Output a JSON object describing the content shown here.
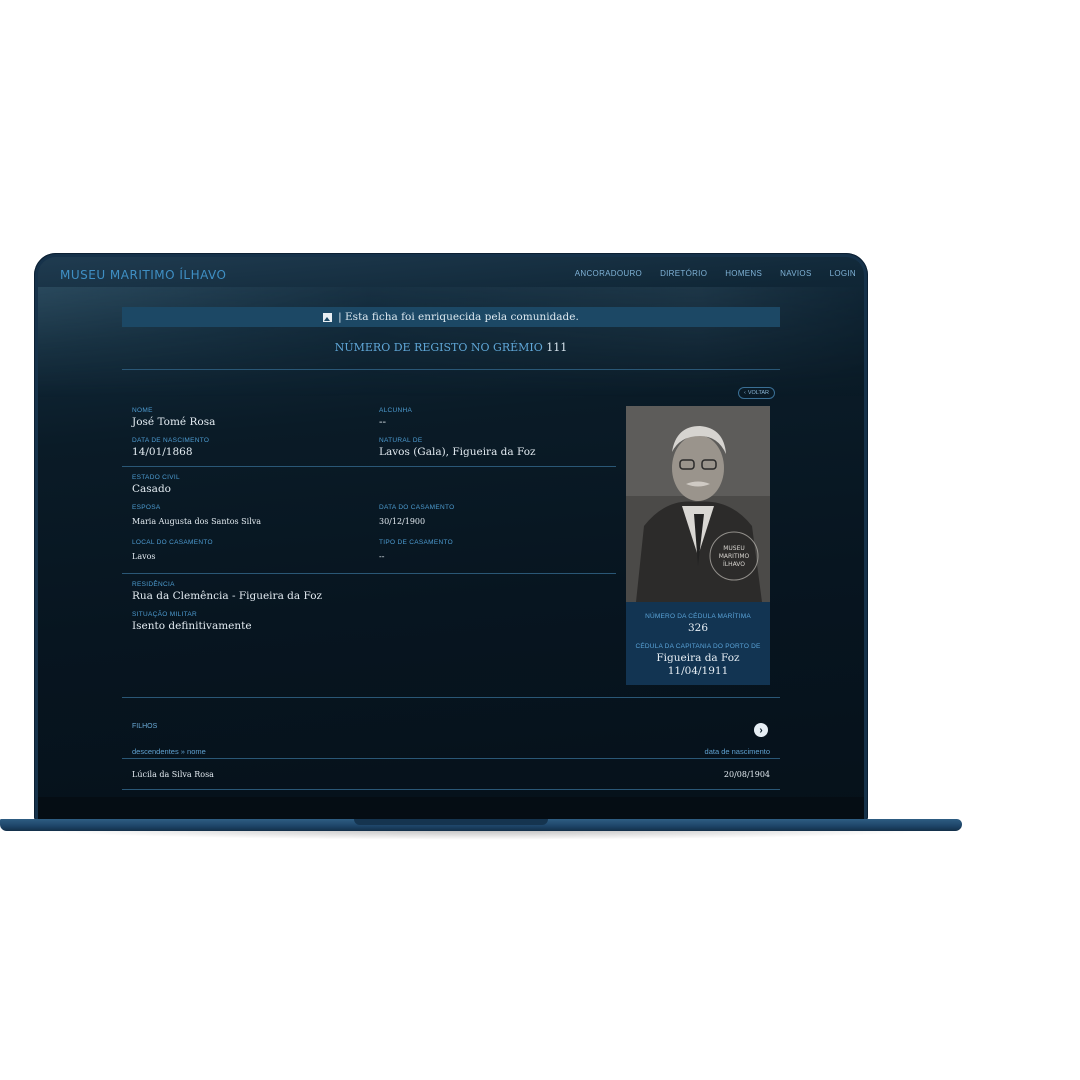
{
  "app": {
    "brand": "MUSEU MARITIMO ÍLHAVO"
  },
  "nav": {
    "items": [
      "ANCORADOURO",
      "DIRETÓRIO",
      "HOMENS",
      "NAVIOS",
      "LOGIN"
    ]
  },
  "notice": {
    "text": "| Esta ficha foi enriquecida pela comunidade."
  },
  "registo": {
    "label": "NÚMERO DE REGISTO NO GRÉMIO",
    "number": "111"
  },
  "voltar": {
    "label": "VOLTAR"
  },
  "person": {
    "nome": {
      "label": "NOME",
      "value": "José Tomé Rosa"
    },
    "alcunha": {
      "label": "ALCUNHA",
      "value": "--"
    },
    "nascimento": {
      "label": "DATA DE NASCIMENTO",
      "value": "14/01/1868"
    },
    "natural": {
      "label": "NATURAL DE",
      "value": "Lavos (Gala), Figueira da Foz"
    },
    "estado_civil": {
      "label": "ESTADO CIVIL",
      "value": "Casado"
    },
    "esposa": {
      "label": "ESPOSA",
      "value": "Maria Augusta dos Santos Silva"
    },
    "data_casamento": {
      "label": "DATA DO CASAMENTO",
      "value": "30/12/1900"
    },
    "local_casamento": {
      "label": "LOCAL DO CASAMENTO",
      "value": "Lavos"
    },
    "tipo_casamento": {
      "label": "TIPO DE CASAMENTO",
      "value": "--"
    },
    "residencia": {
      "label": "RESIDÊNCIA",
      "value": "Rua da Clemência - Figueira da Foz"
    },
    "militar": {
      "label": "SITUAÇÃO MILITAR",
      "value": "Isento definitivamente"
    }
  },
  "card": {
    "watermark": [
      "MUSEU",
      "MARITIMO",
      "ÍLHAVO"
    ],
    "cedula": {
      "label": "NÚMERO DA CÉDULA MARÍTIMA",
      "value": "326"
    },
    "capitania": {
      "label": "CÉDULA DA CAPITANIA DO PORTO DE",
      "value": "Figueira da Foz",
      "date": "11/04/1911"
    }
  },
  "filhos": {
    "label": "FILHOS",
    "col_left": "descendentes » nome",
    "col_right": "data de nascimento",
    "rows": [
      {
        "nome": "Lúcila da Silva Rosa",
        "data": "20/08/1904"
      }
    ]
  }
}
